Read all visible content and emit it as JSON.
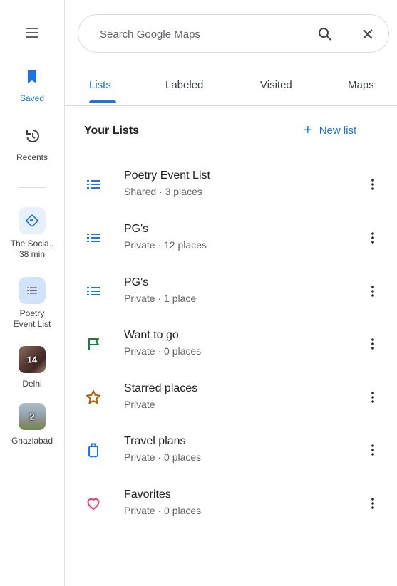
{
  "search": {
    "placeholder": "Search Google Maps"
  },
  "rail": {
    "saved_label": "Saved",
    "recents_label": "Recents",
    "recent_place": {
      "label_line1": "The Socia..",
      "label_line2": "38 min"
    },
    "poetry": {
      "label_line1": "Poetry",
      "label_line2": "Event List"
    },
    "delhi": {
      "label": "Delhi",
      "count": "14"
    },
    "ghaziabad": {
      "label": "Ghaziabad",
      "count": "2"
    }
  },
  "tabs": [
    "Lists",
    "Labeled",
    "Visited",
    "Maps"
  ],
  "section": {
    "title": "Your Lists",
    "new_list_label": "New list",
    "new_list_icon": "+"
  },
  "lists": [
    {
      "name": "Poetry Event List",
      "meta": "Shared · 3 places",
      "icon": "list-icon"
    },
    {
      "name": "PG's",
      "meta": "Private · 12 places",
      "icon": "list-icon"
    },
    {
      "name": "PG's",
      "meta": "Private · 1 place",
      "icon": "list-icon"
    },
    {
      "name": "Want to go",
      "meta": "Private · 0 places",
      "icon": "flag-icon"
    },
    {
      "name": "Starred places",
      "meta": "Private",
      "icon": "star-icon"
    },
    {
      "name": "Travel plans",
      "meta": "Private · 0 places",
      "icon": "suitcase-icon"
    },
    {
      "name": "Favorites",
      "meta": "Private · 0 places",
      "icon": "heart-icon"
    }
  ],
  "colors": {
    "accent": "#1a73e8",
    "list_icon": "#1a73e8",
    "flag": "#188038",
    "star": "#b06000",
    "suitcase": "#1a73e8",
    "heart": "#e8437d"
  }
}
